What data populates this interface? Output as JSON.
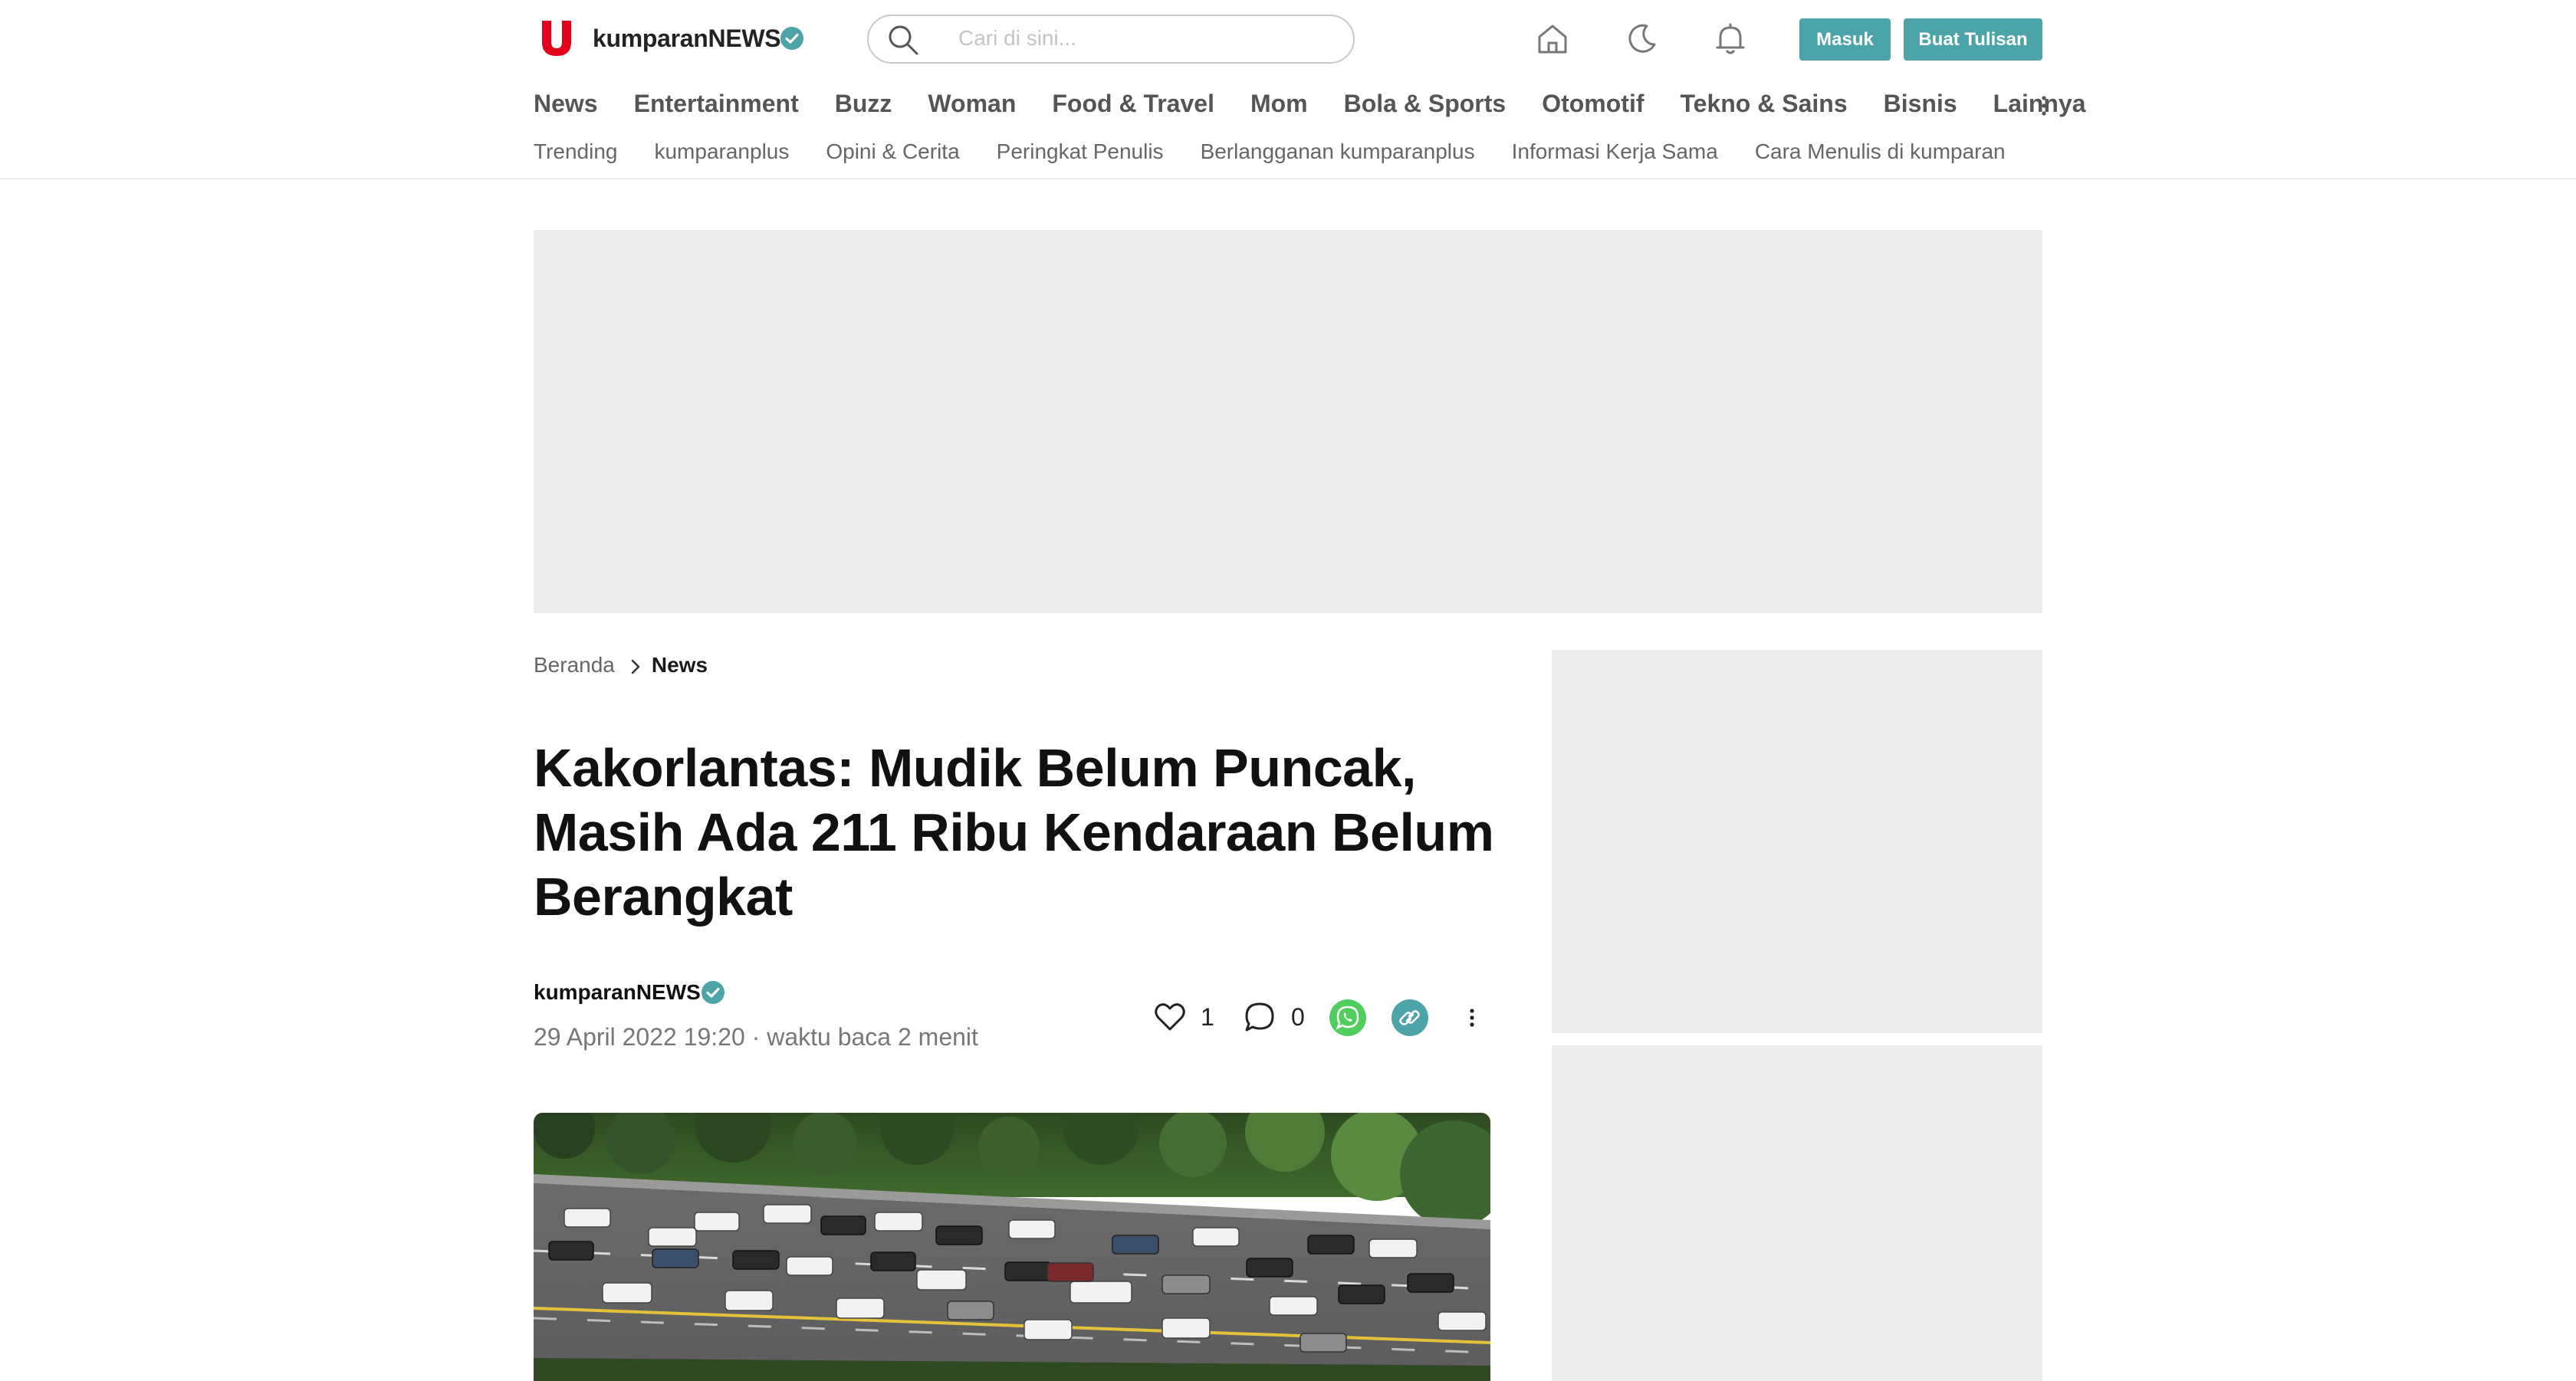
{
  "colors": {
    "brand_red": "#e2001a",
    "accent_teal": "#4ca3a8",
    "ad_placeholder": "#ededed",
    "verified_badge": "#4ca3a8",
    "whatsapp_green": "#4fce5d"
  },
  "header": {
    "channel_name": "kumparanNEWS",
    "logo_icon": "kumparan-logo-icon",
    "search": {
      "placeholder": "Cari di sini..."
    },
    "icons": [
      "home-icon",
      "moon-icon",
      "bell-icon"
    ],
    "buttons": {
      "login": "Masuk",
      "write": "Buat Tulisan"
    }
  },
  "nav": {
    "main": [
      "News",
      "Entertainment",
      "Buzz",
      "Woman",
      "Food & Travel",
      "Mom",
      "Bola & Sports",
      "Otomotif",
      "Tekno & Sains",
      "Bisnis",
      "Lainnya"
    ],
    "sub": [
      "Trending",
      "kumparanplus",
      "Opini & Cerita",
      "Peringkat Penulis",
      "Berlangganan kumparanplus",
      "Informasi Kerja Sama",
      "Cara Menulis di kumparan"
    ]
  },
  "breadcrumb": {
    "home": "Beranda",
    "current": "News"
  },
  "article": {
    "title": "Kakorlantas: Mudik Belum Puncak, Masih Ada 211 Ribu Kendaraan Belum Berangkat",
    "author": "kumparanNEWS",
    "meta": "29 April 2022 19:20 · waktu baca 2 menit",
    "likes": "1",
    "comments": "0"
  }
}
